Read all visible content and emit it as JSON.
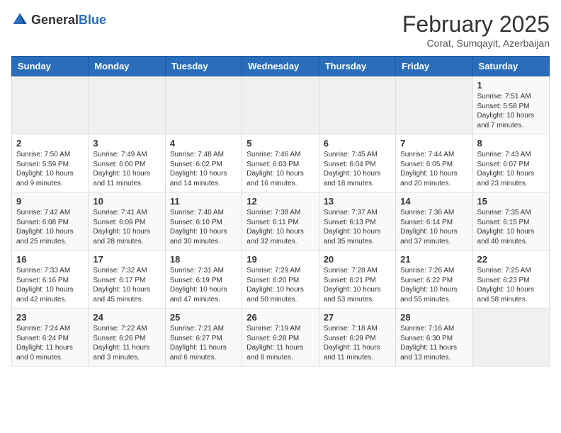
{
  "logo": {
    "text_general": "General",
    "text_blue": "Blue"
  },
  "title": "February 2025",
  "subtitle": "Corat, Sumqayit, Azerbaijan",
  "days_of_week": [
    "Sunday",
    "Monday",
    "Tuesday",
    "Wednesday",
    "Thursday",
    "Friday",
    "Saturday"
  ],
  "weeks": [
    [
      {
        "day": "",
        "info": ""
      },
      {
        "day": "",
        "info": ""
      },
      {
        "day": "",
        "info": ""
      },
      {
        "day": "",
        "info": ""
      },
      {
        "day": "",
        "info": ""
      },
      {
        "day": "",
        "info": ""
      },
      {
        "day": "1",
        "info": "Sunrise: 7:51 AM\nSunset: 5:58 PM\nDaylight: 10 hours and 7 minutes."
      }
    ],
    [
      {
        "day": "2",
        "info": "Sunrise: 7:50 AM\nSunset: 5:59 PM\nDaylight: 10 hours and 9 minutes."
      },
      {
        "day": "3",
        "info": "Sunrise: 7:49 AM\nSunset: 6:00 PM\nDaylight: 10 hours and 11 minutes."
      },
      {
        "day": "4",
        "info": "Sunrise: 7:48 AM\nSunset: 6:02 PM\nDaylight: 10 hours and 14 minutes."
      },
      {
        "day": "5",
        "info": "Sunrise: 7:46 AM\nSunset: 6:03 PM\nDaylight: 10 hours and 16 minutes."
      },
      {
        "day": "6",
        "info": "Sunrise: 7:45 AM\nSunset: 6:04 PM\nDaylight: 10 hours and 18 minutes."
      },
      {
        "day": "7",
        "info": "Sunrise: 7:44 AM\nSunset: 6:05 PM\nDaylight: 10 hours and 20 minutes."
      },
      {
        "day": "8",
        "info": "Sunrise: 7:43 AM\nSunset: 6:07 PM\nDaylight: 10 hours and 23 minutes."
      }
    ],
    [
      {
        "day": "9",
        "info": "Sunrise: 7:42 AM\nSunset: 6:08 PM\nDaylight: 10 hours and 25 minutes."
      },
      {
        "day": "10",
        "info": "Sunrise: 7:41 AM\nSunset: 6:09 PM\nDaylight: 10 hours and 28 minutes."
      },
      {
        "day": "11",
        "info": "Sunrise: 7:40 AM\nSunset: 6:10 PM\nDaylight: 10 hours and 30 minutes."
      },
      {
        "day": "12",
        "info": "Sunrise: 7:38 AM\nSunset: 6:11 PM\nDaylight: 10 hours and 32 minutes."
      },
      {
        "day": "13",
        "info": "Sunrise: 7:37 AM\nSunset: 6:13 PM\nDaylight: 10 hours and 35 minutes."
      },
      {
        "day": "14",
        "info": "Sunrise: 7:36 AM\nSunset: 6:14 PM\nDaylight: 10 hours and 37 minutes."
      },
      {
        "day": "15",
        "info": "Sunrise: 7:35 AM\nSunset: 6:15 PM\nDaylight: 10 hours and 40 minutes."
      }
    ],
    [
      {
        "day": "16",
        "info": "Sunrise: 7:33 AM\nSunset: 6:16 PM\nDaylight: 10 hours and 42 minutes."
      },
      {
        "day": "17",
        "info": "Sunrise: 7:32 AM\nSunset: 6:17 PM\nDaylight: 10 hours and 45 minutes."
      },
      {
        "day": "18",
        "info": "Sunrise: 7:31 AM\nSunset: 6:19 PM\nDaylight: 10 hours and 47 minutes."
      },
      {
        "day": "19",
        "info": "Sunrise: 7:29 AM\nSunset: 6:20 PM\nDaylight: 10 hours and 50 minutes."
      },
      {
        "day": "20",
        "info": "Sunrise: 7:28 AM\nSunset: 6:21 PM\nDaylight: 10 hours and 53 minutes."
      },
      {
        "day": "21",
        "info": "Sunrise: 7:26 AM\nSunset: 6:22 PM\nDaylight: 10 hours and 55 minutes."
      },
      {
        "day": "22",
        "info": "Sunrise: 7:25 AM\nSunset: 6:23 PM\nDaylight: 10 hours and 58 minutes."
      }
    ],
    [
      {
        "day": "23",
        "info": "Sunrise: 7:24 AM\nSunset: 6:24 PM\nDaylight: 11 hours and 0 minutes."
      },
      {
        "day": "24",
        "info": "Sunrise: 7:22 AM\nSunset: 6:26 PM\nDaylight: 11 hours and 3 minutes."
      },
      {
        "day": "25",
        "info": "Sunrise: 7:21 AM\nSunset: 6:27 PM\nDaylight: 11 hours and 6 minutes."
      },
      {
        "day": "26",
        "info": "Sunrise: 7:19 AM\nSunset: 6:28 PM\nDaylight: 11 hours and 8 minutes."
      },
      {
        "day": "27",
        "info": "Sunrise: 7:18 AM\nSunset: 6:29 PM\nDaylight: 11 hours and 11 minutes."
      },
      {
        "day": "28",
        "info": "Sunrise: 7:16 AM\nSunset: 6:30 PM\nDaylight: 11 hours and 13 minutes."
      },
      {
        "day": "",
        "info": ""
      }
    ]
  ]
}
